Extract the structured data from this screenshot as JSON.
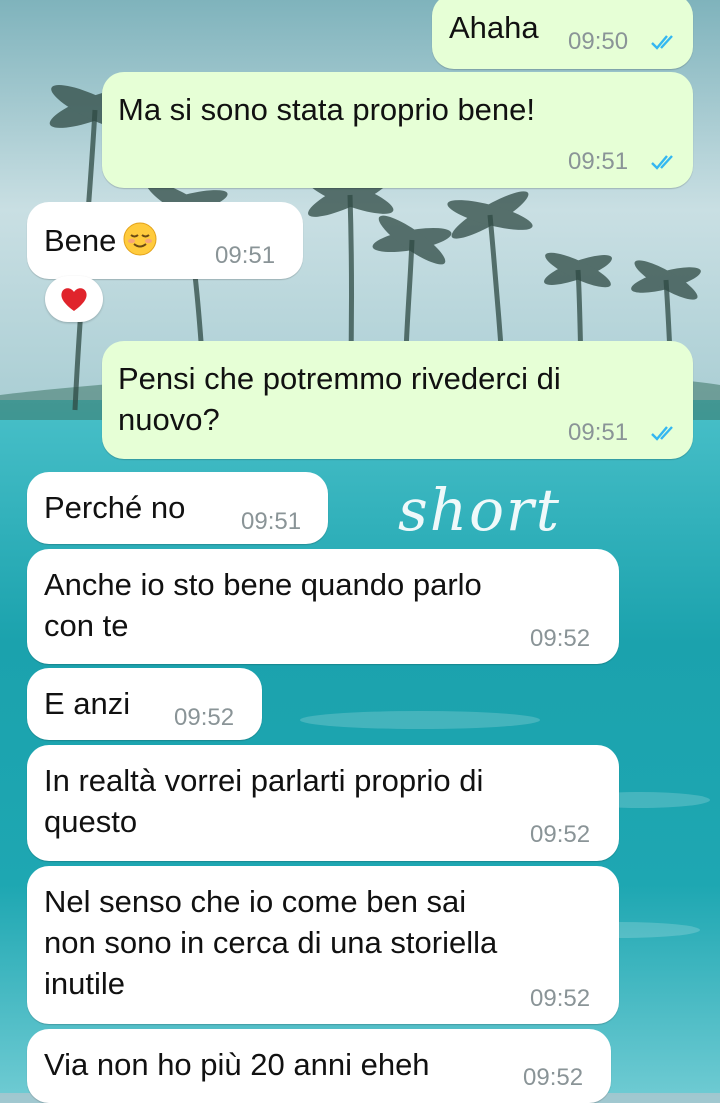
{
  "wallpaper": {
    "overlay_text": "short",
    "colors": {
      "sky": "#b9d6dd",
      "sea": "#1aa3ae",
      "outgoing_bubble": "#e6ffd6",
      "incoming_bubble": "#ffffff",
      "read_ticks": "#34b7f1"
    }
  },
  "messages": [
    {
      "text_lines": [
        "Ahaha"
      ],
      "time": "09:50",
      "read": true
    },
    {
      "text_lines": [
        "Ma si sono stata proprio bene!"
      ],
      "time": "09:51",
      "read": true
    },
    {
      "text_lines": [
        "Bene"
      ],
      "emoji": "relieved-smiling-face",
      "time": "09:51",
      "reaction": "red-heart"
    },
    {
      "text_lines": [
        "Pensi che potremmo rivederci di",
        "nuovo?"
      ],
      "time": "09:51",
      "read": true
    },
    {
      "text_lines": [
        "Perché no"
      ],
      "time": "09:51"
    },
    {
      "text_lines": [
        "Anche io sto bene quando parlo",
        "con te"
      ],
      "time": "09:52"
    },
    {
      "text_lines": [
        "E anzi"
      ],
      "time": "09:52"
    },
    {
      "text_lines": [
        "In realtà vorrei parlarti proprio di",
        "questo"
      ],
      "time": "09:52"
    },
    {
      "text_lines": [
        "Nel senso che io come ben sai",
        "non sono in cerca di una storiella",
        "inutile"
      ],
      "time": "09:52"
    },
    {
      "text_lines": [
        "Via non ho più 20 anni eheh"
      ],
      "time": "09:52"
    }
  ]
}
